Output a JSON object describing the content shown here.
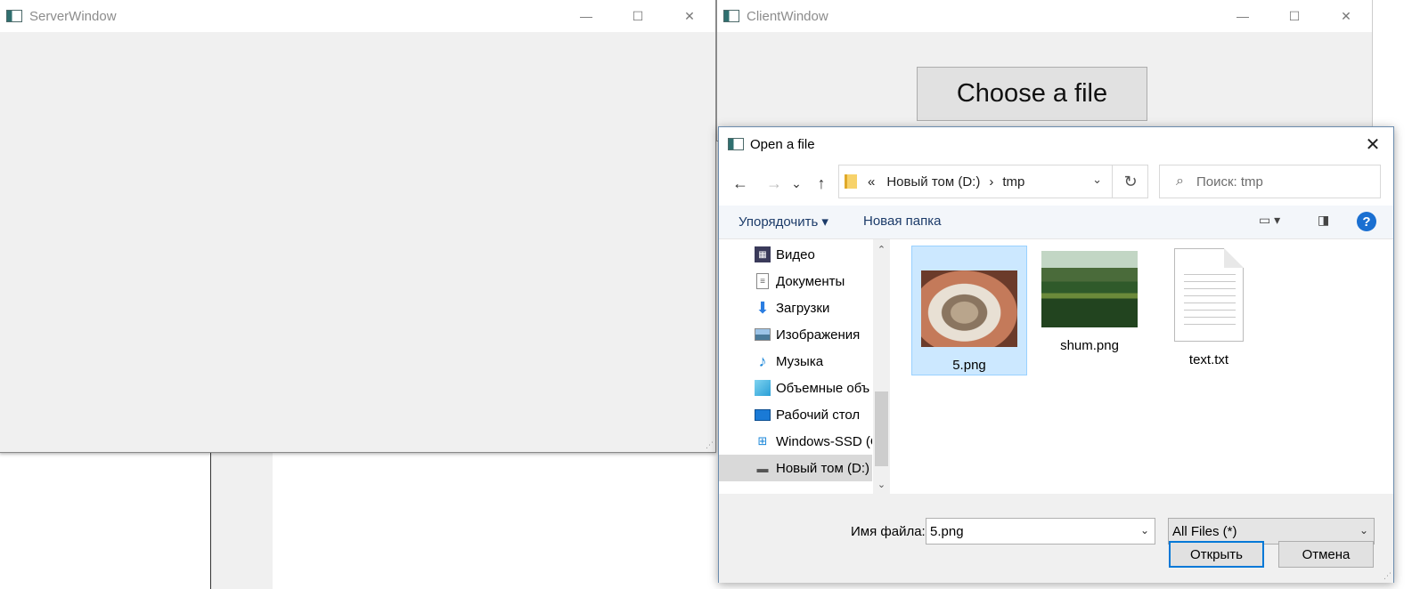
{
  "server_window": {
    "title": "ServerWindow"
  },
  "client_window": {
    "title": "ClientWindow",
    "choose_button": "Choose a file"
  },
  "window_controls": {
    "minimize": "—",
    "maximize": "☐",
    "close": "✕"
  },
  "dialog": {
    "title": "Open a file",
    "nav": {
      "back": "←",
      "forward": "→",
      "recent": "⌄",
      "up": "↑"
    },
    "address": {
      "chevrons": "«",
      "segments": [
        "Новый том (D:)",
        "tmp"
      ],
      "separator": "›"
    },
    "refresh": "↻",
    "search_placeholder": "Поиск: tmp",
    "commands": {
      "organize": "Упорядочить ▾",
      "new_folder": "Новая папка"
    },
    "help": "?",
    "nav_items": [
      {
        "label": "Видео",
        "icon": "video-icon"
      },
      {
        "label": "Документы",
        "icon": "documents-icon"
      },
      {
        "label": "Загрузки",
        "icon": "downloads-icon"
      },
      {
        "label": "Изображения",
        "icon": "pictures-icon"
      },
      {
        "label": "Музыка",
        "icon": "music-icon"
      },
      {
        "label": "Объемные объ",
        "icon": "3d-objects-icon"
      },
      {
        "label": "Рабочий стол",
        "icon": "desktop-icon"
      },
      {
        "label": "Windows-SSD (C",
        "icon": "windows-drive-icon"
      },
      {
        "label": "Новый том (D:)",
        "icon": "drive-icon",
        "selected": true
      }
    ],
    "files": [
      {
        "name": "5.png",
        "selected": true
      },
      {
        "name": "shum.png"
      },
      {
        "name": "text.txt"
      }
    ],
    "file_name_label": "Имя файла:",
    "file_name_value": "5.png",
    "file_type": "All Files (*)",
    "open_button": "Открыть",
    "cancel_button": "Отмена"
  }
}
